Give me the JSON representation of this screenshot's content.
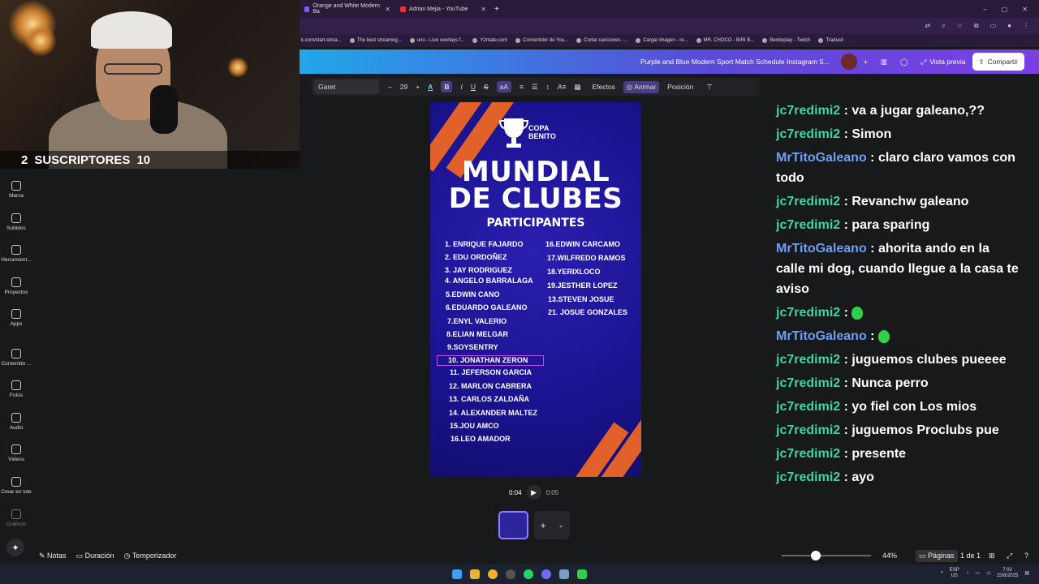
{
  "webcam": {
    "subscribers_current": "2",
    "subscribers_label": "SUSCRIPTORES",
    "subscribers_goal": "10"
  },
  "browser": {
    "tabs": [
      {
        "label": "Orange and White Modern Ba",
        "color": "#7b5cff"
      },
      {
        "label": "Adrian Mejia - YouTube",
        "color": "#ff2a2a"
      }
    ],
    "bookmarks": [
      "k.com/start-strea...",
      "The best streamog...",
      "uno - Live overlays f...",
      "Y2mate.com",
      "Convertidor de You...",
      "Cortar canciones -...",
      "Cargar imagen - re...",
      "MR. CHOCO - BIRI B...",
      "Benitoplay - Twitch",
      "Traducir"
    ]
  },
  "canva_header": {
    "doc_title": "Purple and Blue Modern Sport Match Schedule Instagram S...",
    "preview_label": "Vista previa",
    "share_label": "Compartir"
  },
  "sidebar": {
    "items": [
      "Marca",
      "Subidos",
      "Herramient...",
      "Proyectos",
      "Apps",
      "Contenido ...",
      "Fotos",
      "Audio",
      "Videos",
      "Crear en lote",
      "Gráficos"
    ]
  },
  "toolbar": {
    "font": "Garet",
    "size": "29",
    "effects": "Efectos",
    "animate": "Animar",
    "position": "Posición",
    "case": "aA"
  },
  "poster": {
    "brand_1": "COPA",
    "brand_2": "BENITO",
    "title_1": "MUNDIAL",
    "title_2": "DE CLUBES",
    "subtitle": "PARTICIPANTES",
    "left_col": [
      "1. ENRIQUE FAJARDO",
      "2. EDU ORDOÑEZ",
      "3. JAY RODRIGUEZ",
      "4. ANGELO BARRALAGA",
      "5.EDWIN CANO",
      "6.EDUARDO GALEANO",
      "7.ENYL VALERIO",
      "8.ELIAN MELGAR",
      "9.SOYSENTRY",
      "10. JONATHAN ZERON",
      "11. JEFERSON GARCIA",
      "12. MARLON CABRERA",
      "13. CARLOS ZALDAÑA",
      "14. ALEXANDER MALTEZ",
      "15.JOU AMCO",
      "16.LEO AMADOR"
    ],
    "right_col": [
      "16.EDWIN CARCAMO",
      "17.WILFREDO RAMOS",
      "18.YERIXLOCO",
      "19.JESTHER LOPEZ",
      "13.STEVEN JOSUE",
      "21. JOSUE GONZALES"
    ]
  },
  "playback": {
    "current": "0:04",
    "total": "0:05"
  },
  "chat": [
    {
      "user": "jc7redimi2",
      "text": "va a jugar galeano,??",
      "color": "#3cd6a0"
    },
    {
      "user": "jc7redimi2",
      "text": "Simon",
      "color": "#3cd6a0"
    },
    {
      "user": "MrTitoGaleano",
      "text": "claro claro vamos con todo",
      "color": "#6f9ff0"
    },
    {
      "user": "jc7redimi2",
      "text": "Revanchw galeano",
      "color": "#3cd6a0"
    },
    {
      "user": "jc7redimi2",
      "text": "para sparing",
      "color": "#3cd6a0"
    },
    {
      "user": "MrTitoGaleano",
      "text": "ahorita ando en la calle mi dog, cuando llegue a la casa te aviso",
      "color": "#6f9ff0"
    },
    {
      "user": "jc7redimi2",
      "text": "",
      "color": "#3cd6a0",
      "emote": true
    },
    {
      "user": "MrTitoGaleano",
      "text": "",
      "color": "#6f9ff0",
      "emote": true
    },
    {
      "user": "jc7redimi2",
      "text": "juguemos clubes pueeee",
      "color": "#3cd6a0"
    },
    {
      "user": "jc7redimi2",
      "text": "Nunca perro",
      "color": "#3cd6a0"
    },
    {
      "user": "jc7redimi2",
      "text": "yo fiel con Los mios",
      "color": "#3cd6a0"
    },
    {
      "user": "jc7redimi2",
      "text": "juguemos Proclubs pue",
      "color": "#3cd6a0"
    },
    {
      "user": "jc7redimi2",
      "text": "presente",
      "color": "#3cd6a0"
    },
    {
      "user": "jc7redimi2",
      "text": "ayo",
      "color": "#3cd6a0"
    }
  ],
  "bottom_bar": {
    "notes": "Notas",
    "duration": "Duración",
    "timer": "Temporizador",
    "zoom": "44%",
    "pages": "Páginas",
    "page_count": "1 de 1"
  },
  "tray": {
    "lang_1": "ESP",
    "lang_2": "US",
    "time": "7:02",
    "date": "15/8/2025"
  }
}
